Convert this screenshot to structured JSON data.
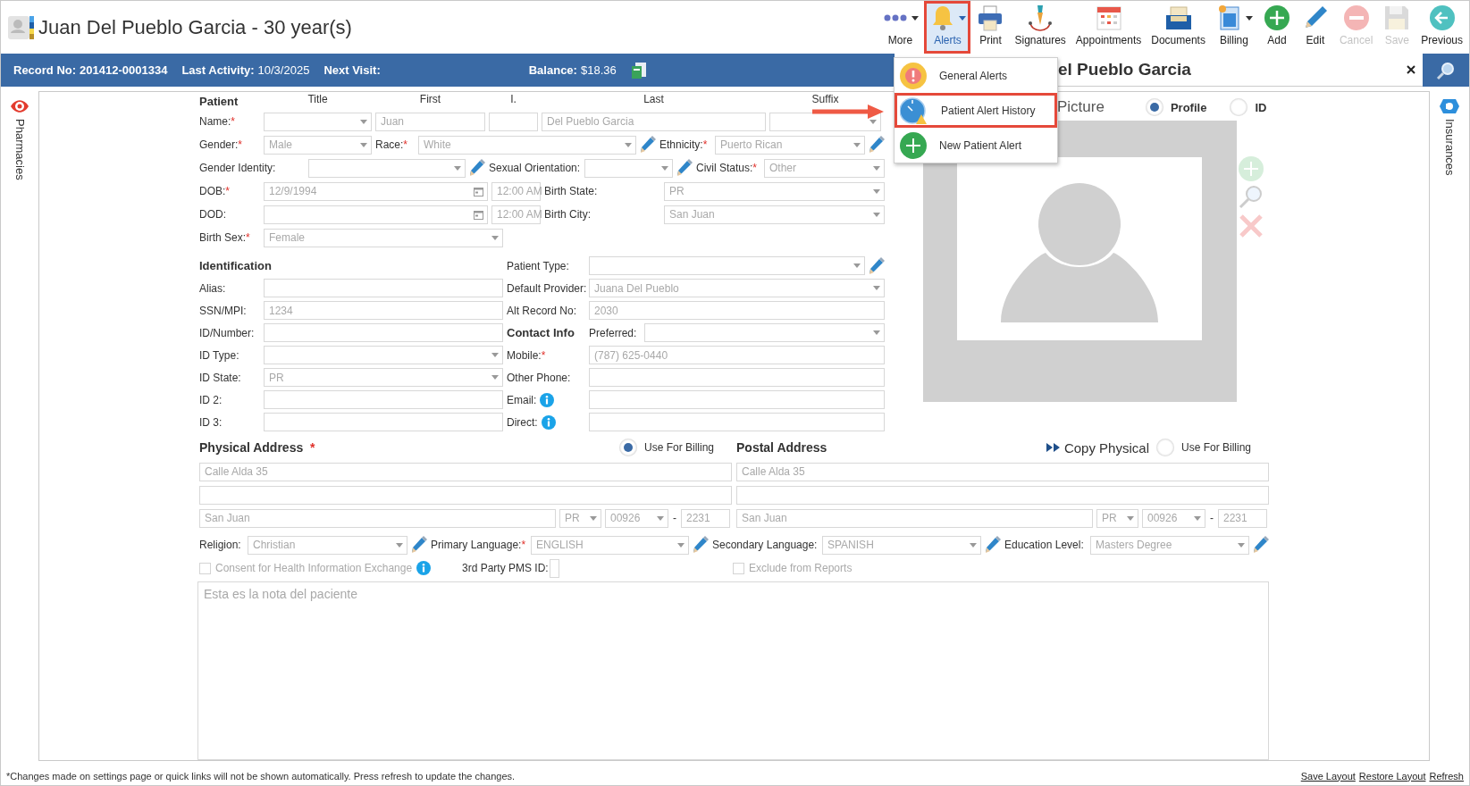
{
  "header": {
    "title": "Juan Del Pueblo Garcia - 30 year(s)"
  },
  "toolbar": [
    {
      "kind": "more",
      "label": "More",
      "has_menu": true,
      "highlighted": false,
      "disabled": false
    },
    {
      "kind": "alerts",
      "label": "Alerts",
      "has_menu": true,
      "highlighted": true,
      "disabled": false
    },
    {
      "kind": "print",
      "label": "Print",
      "has_menu": false,
      "highlighted": false,
      "disabled": false
    },
    {
      "kind": "signatures",
      "label": "Signatures",
      "has_menu": false,
      "highlighted": false,
      "disabled": false
    },
    {
      "kind": "appointments",
      "label": "Appointments",
      "has_menu": false,
      "highlighted": false,
      "disabled": false
    },
    {
      "kind": "documents",
      "label": "Documents",
      "has_menu": false,
      "highlighted": false,
      "disabled": false
    },
    {
      "kind": "billing",
      "label": "Billing",
      "has_menu": true,
      "highlighted": false,
      "disabled": false
    },
    {
      "kind": "add",
      "label": "Add",
      "has_menu": false,
      "highlighted": false,
      "disabled": false
    },
    {
      "kind": "edit",
      "label": "Edit",
      "has_menu": false,
      "highlighted": false,
      "disabled": false
    },
    {
      "kind": "cancel",
      "label": "Cancel",
      "has_menu": false,
      "highlighted": false,
      "disabled": true
    },
    {
      "kind": "save",
      "label": "Save",
      "has_menu": false,
      "highlighted": false,
      "disabled": true
    },
    {
      "kind": "previous",
      "label": "Previous",
      "has_menu": false,
      "highlighted": false,
      "disabled": false
    }
  ],
  "alerts_menu": [
    {
      "kind": "general",
      "label": "General Alerts",
      "highlighted": false
    },
    {
      "kind": "history",
      "label": "Patient Alert History",
      "highlighted": true
    },
    {
      "kind": "new",
      "label": "New Patient Alert",
      "highlighted": false
    }
  ],
  "info_bar": [
    {
      "label": "Record No:",
      "value": "201412-0001334",
      "value_bold": true
    },
    {
      "label": "Last Activity:",
      "value": "10/3/2025",
      "value_bold": false
    },
    {
      "label": "Next Visit:"
    },
    {
      "label": "Balance:",
      "value": "$18.36",
      "value_bold": false
    }
  ],
  "panel_header": {
    "title": "el Pueblo Garcia"
  },
  "left_tab": {
    "label": "Pharmacies"
  },
  "right_tab": {
    "label": "Insurances"
  },
  "patient": {
    "heading": "Patient",
    "column_headers": [
      "Title",
      "First",
      "I.",
      "Last",
      "Suffix"
    ],
    "rows": [
      {
        "fields": [
          {
            "label": "Name:",
            "mark": "*",
            "inputs": [
              {
                "kind": "select"
              },
              {
                "kind": "text",
                "value": "Juan"
              },
              {
                "kind": "text"
              },
              {
                "kind": "text",
                "value": "Del Pueblo Garcia"
              },
              {
                "kind": "select"
              }
            ]
          }
        ]
      },
      {
        "fields": [
          {
            "label": "Gender:",
            "mark": "*",
            "inputs": [
              {
                "kind": "select",
                "value": "Male"
              }
            ]
          },
          {
            "label": "Race:",
            "mark": "*",
            "inputs": [
              {
                "kind": "select",
                "value": "White",
                "edit": true
              }
            ]
          },
          {
            "label": "Ethnicity:",
            "mark": "*",
            "inputs": [
              {
                "kind": "select",
                "value": "Puerto Rican",
                "edit": true
              }
            ]
          }
        ]
      },
      {
        "fields": [
          {
            "label": "Gender Identity:",
            "inputs": [
              {
                "kind": "select",
                "edit": true
              }
            ]
          },
          {
            "label": "Sexual Orientation:",
            "inputs": [
              {
                "kind": "select",
                "edit": true
              }
            ]
          },
          {
            "label": "Civil Status:",
            "mark": "*",
            "inputs": [
              {
                "kind": "select",
                "value": "Other"
              }
            ]
          }
        ]
      },
      {
        "fields": [
          {
            "label": "DOB:",
            "mark": "*",
            "inputs": [
              {
                "kind": "date",
                "value": "12/9/1994"
              },
              {
                "kind": "time",
                "value": "12:00 AM"
              }
            ]
          },
          {
            "label": "Birth State:",
            "inputs": [
              {
                "kind": "select",
                "value": "PR"
              }
            ]
          }
        ]
      },
      {
        "fields": [
          {
            "label": "DOD:",
            "inputs": [
              {
                "kind": "date"
              },
              {
                "kind": "time",
                "value": "12:00 AM"
              }
            ]
          },
          {
            "label": "Birth City:",
            "inputs": [
              {
                "kind": "select",
                "value": "San Juan"
              }
            ]
          }
        ]
      },
      {
        "fields": [
          {
            "label": "Birth Sex:",
            "mark": "*",
            "inputs": [
              {
                "kind": "select",
                "value": "Female"
              }
            ]
          }
        ]
      }
    ]
  },
  "identification": {
    "rows": [
      {
        "fields": [
          {
            "heading": "Identification"
          },
          {
            "label": "Patient Type:",
            "inputs": [
              {
                "kind": "select",
                "edit": true
              }
            ]
          }
        ]
      },
      {
        "fields": [
          {
            "label": "Alias:",
            "inputs": [
              {
                "kind": "text"
              }
            ]
          },
          {
            "label": "Default Provider:",
            "inputs": [
              {
                "kind": "select",
                "value": "Juana Del Pueblo"
              }
            ]
          }
        ]
      },
      {
        "fields": [
          {
            "label": "SSN/MPI:",
            "inputs": [
              {
                "kind": "text",
                "value": "1234"
              }
            ]
          },
          {
            "label": "Alt Record No:",
            "inputs": [
              {
                "kind": "text",
                "value": "2030"
              }
            ]
          }
        ]
      },
      {
        "fields": [
          {
            "label": "ID/Number:",
            "inputs": [
              {
                "kind": "text"
              }
            ]
          },
          {
            "heading": "Contact Info"
          },
          {
            "label": "Preferred:",
            "inputs": [
              {
                "kind": "select"
              }
            ]
          }
        ]
      },
      {
        "fields": [
          {
            "label": "ID Type:",
            "inputs": [
              {
                "kind": "select"
              }
            ]
          },
          {
            "label": "Mobile:",
            "mark": "*",
            "inputs": [
              {
                "kind": "text",
                "value": "(787) 625-0440"
              }
            ]
          }
        ]
      },
      {
        "fields": [
          {
            "label": "ID State:",
            "inputs": [
              {
                "kind": "select",
                "value": "PR"
              }
            ]
          },
          {
            "label": "Other Phone:",
            "inputs": [
              {
                "kind": "text"
              }
            ]
          }
        ]
      },
      {
        "fields": [
          {
            "label": "ID 2:",
            "inputs": [
              {
                "kind": "text"
              }
            ]
          },
          {
            "label": "Email:",
            "info": true,
            "inputs": [
              {
                "kind": "text"
              }
            ]
          }
        ]
      },
      {
        "fields": [
          {
            "label": "ID 3:",
            "inputs": [
              {
                "kind": "text"
              }
            ]
          },
          {
            "label": "Direct:",
            "info": true,
            "inputs": [
              {
                "kind": "text"
              }
            ]
          }
        ]
      }
    ]
  },
  "picture": {
    "heading": "Picture",
    "options": [
      {
        "label": "Profile",
        "selected": true
      },
      {
        "label": "ID",
        "selected": false
      }
    ]
  },
  "addresses": [
    {
      "heading": "Physical Address",
      "mark": "*",
      "billing": {
        "label": "Use For Billing",
        "selected": true
      },
      "line1": "Calle Alda 35",
      "city": "San Juan",
      "state": "PR",
      "zip": "00926",
      "separator": "-",
      "zip_ext": "2231"
    },
    {
      "heading": "Postal Address",
      "copy_label": "Copy Physical",
      "billing": {
        "label": "Use For Billing",
        "selected": false
      },
      "line1": "Calle Alda 35",
      "city": "San Juan",
      "state": "PR",
      "zip": "00926",
      "separator": "-",
      "zip_ext": "2231"
    }
  ],
  "details": [
    {
      "label": "Religion:",
      "value": "Christian"
    },
    {
      "label": "Primary Language:",
      "mark": "*",
      "value": "ENGLISH"
    },
    {
      "label": "Secondary Language:",
      "value": "SPANISH"
    },
    {
      "label": "Education Level:",
      "value": "Masters Degree"
    }
  ],
  "consent": {
    "label": "Consent for Health Information Exchange",
    "checked": false,
    "disabled": true
  },
  "pms_id": {
    "label": "3rd Party PMS ID:"
  },
  "exclude": {
    "label": "Exclude from Reports",
    "checked": false,
    "disabled": true
  },
  "notes": {
    "value": "Esta es la nota del paciente"
  },
  "footer": {
    "note": "*Changes made on settings page or quick links will not be shown automatically. Press refresh to update the changes.",
    "links": [
      "Save Layout",
      "Restore Layout",
      "Refresh"
    ]
  }
}
